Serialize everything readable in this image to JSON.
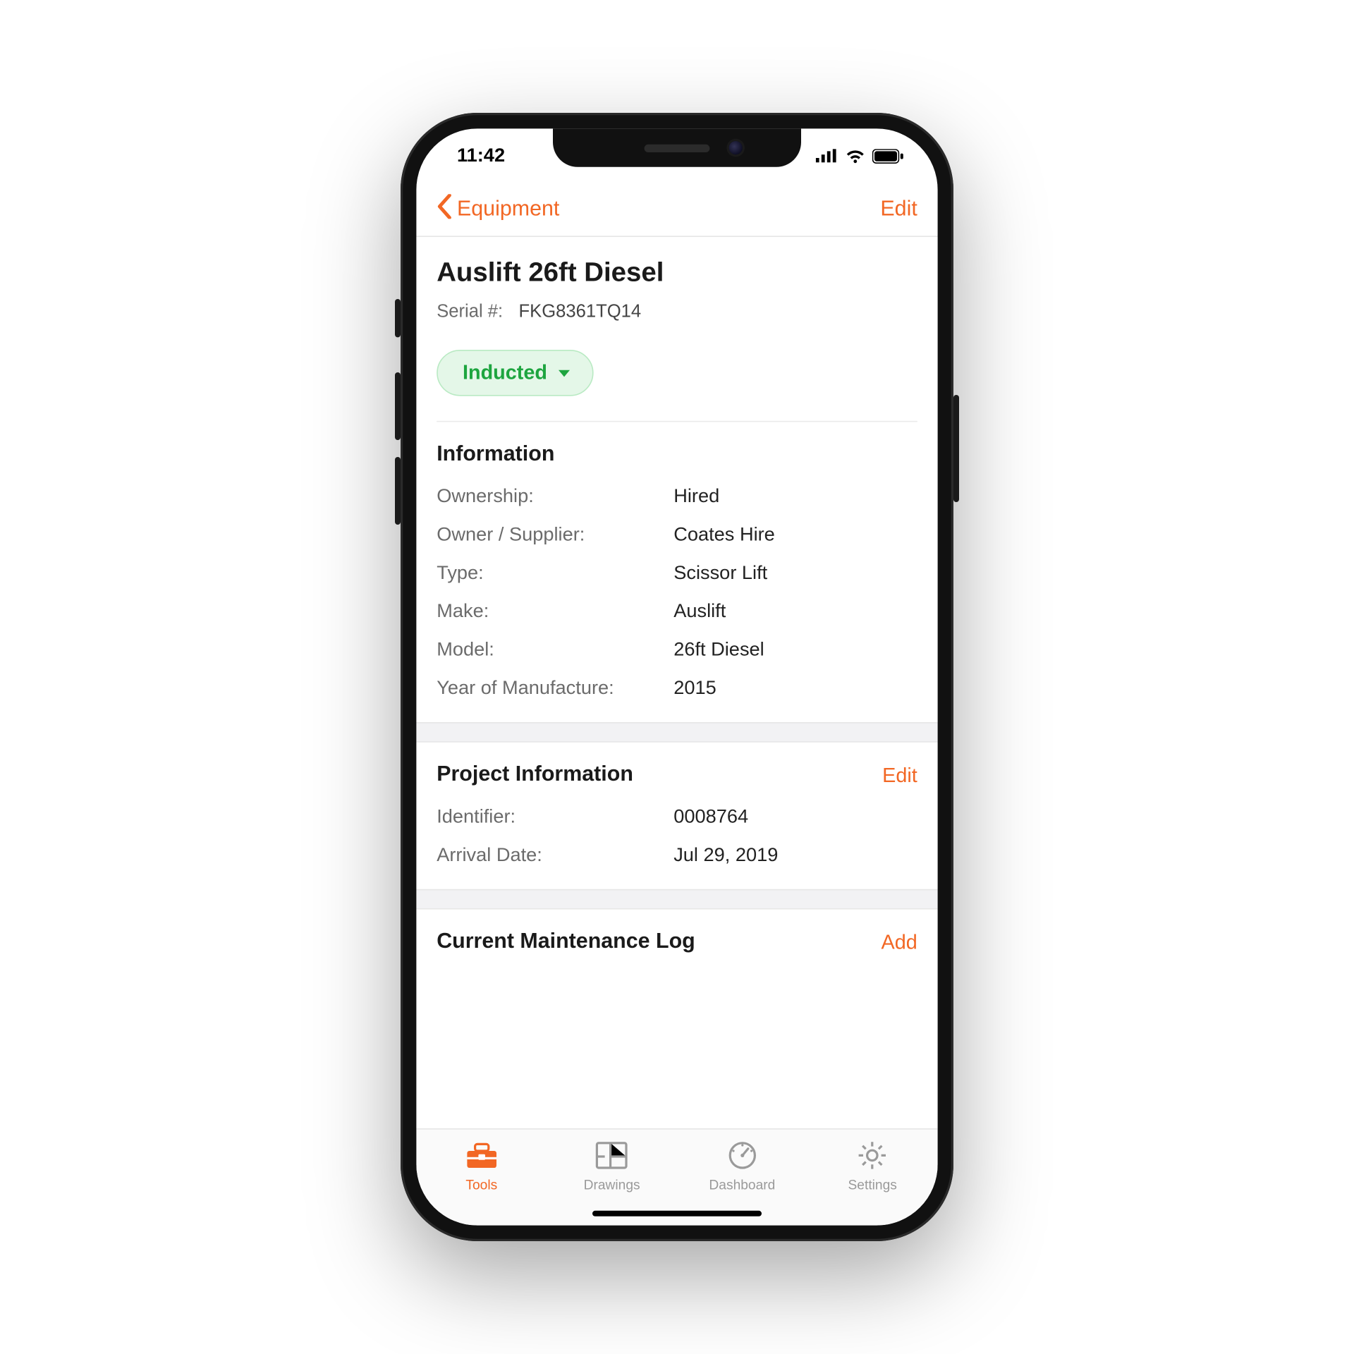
{
  "status_bar": {
    "time": "11:42"
  },
  "nav": {
    "back_label": "Equipment",
    "edit_label": "Edit"
  },
  "header": {
    "title": "Auslift 26ft Diesel",
    "serial_label": "Serial #:",
    "serial_value": "FKG8361TQ14",
    "status_label": "Inducted"
  },
  "information": {
    "title": "Information",
    "rows": [
      {
        "key": "Ownership:",
        "val": "Hired"
      },
      {
        "key": "Owner / Supplier:",
        "val": "Coates Hire"
      },
      {
        "key": "Type:",
        "val": "Scissor Lift"
      },
      {
        "key": "Make:",
        "val": "Auslift"
      },
      {
        "key": "Model:",
        "val": "26ft Diesel"
      },
      {
        "key": "Year of Manufacture:",
        "val": "2015"
      }
    ]
  },
  "project": {
    "title": "Project Information",
    "action_label": "Edit",
    "rows": [
      {
        "key": "Identifier:",
        "val": "0008764"
      },
      {
        "key": "Arrival Date:",
        "val": "Jul 29, 2019"
      }
    ]
  },
  "maintenance": {
    "title": "Current Maintenance Log",
    "action_label": "Add"
  },
  "tabs": [
    {
      "label": "Tools"
    },
    {
      "label": "Drawings"
    },
    {
      "label": "Dashboard"
    },
    {
      "label": "Settings"
    }
  ]
}
